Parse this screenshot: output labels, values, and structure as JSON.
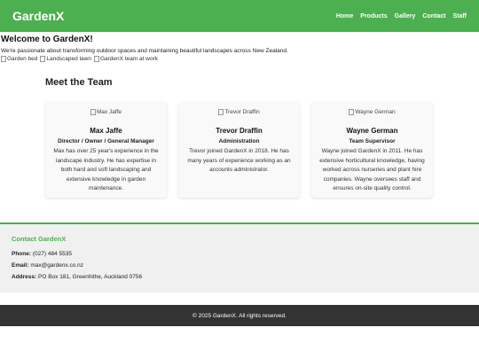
{
  "header": {
    "logo": "GardenX",
    "nav": [
      "Home",
      "Products",
      "Gallery",
      "Contact",
      "Staff"
    ]
  },
  "welcome": {
    "title": "Welcome to GardenX!",
    "intro": "We're passionate about transforming outdoor spaces and maintaining beautiful landscapes across New Zealand.",
    "images": [
      "Garden bed",
      "Landscaped lawn",
      "GardenX team at work"
    ]
  },
  "team": {
    "heading": "Meet the Team",
    "members": [
      {
        "img_alt": "Max Jaffe",
        "name": "Max Jaffe",
        "role": "Director / Owner / General Manager",
        "bio": "Max has over 25 year's experience in the landscape industry. He has expertise in both hard and soft landscaping and extensive knowledge in garden maintenance."
      },
      {
        "img_alt": "Trevor Draffin",
        "name": "Trevor Draffin",
        "role": "Administration",
        "bio": "Trevor joined GardenX in 2018. He has many years of experience working as an accounts administrator."
      },
      {
        "img_alt": "Wayne German",
        "name": "Wayne German",
        "role": "Team Supervisor",
        "bio": "Wayne joined GardenX in 2011. He has extensive horticultural knowledge, having worked across nurseries and plant hire companies. Wayne oversees staff and ensures on-site quality control."
      }
    ]
  },
  "contact": {
    "heading": "Contact GardenX",
    "phone_label": "Phone:",
    "phone": "(027) 484 5535",
    "email_label": "Email:",
    "email": "max@gardenx.co.nz",
    "address_label": "Address:",
    "address": "PO Box 181, Greenhithe, Auckland 0756"
  },
  "footer": {
    "text": "© 2025 GardenX. All rights reserved."
  },
  "colors": {
    "brand": "#4caf50",
    "footer_bg": "#333333",
    "contact_bg": "#f0f0f0"
  }
}
